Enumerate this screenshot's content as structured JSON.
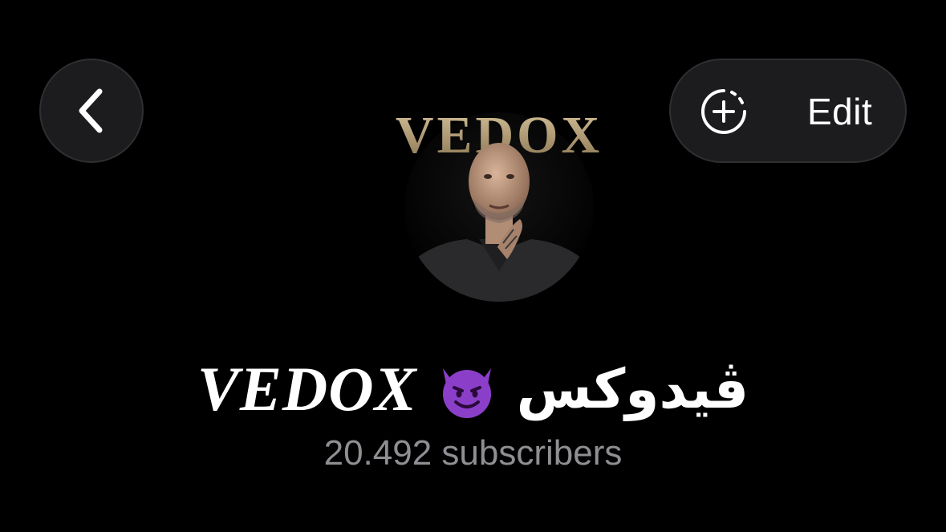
{
  "header": {
    "back_icon": "chevron-left-icon",
    "edit_icon": "add-story-icon",
    "edit_label": "Edit"
  },
  "profile": {
    "avatar_logo_text": "VEDOX",
    "name_latin": "VEDOX",
    "name_emoji": "smiling-face-with-horns-icon",
    "name_arabic": "ڤيدوكس",
    "subscribers": "20.492 subscribers"
  },
  "colors": {
    "background": "#000000",
    "button_bg": "#1c1c1e",
    "secondary_text": "#8e8e93",
    "devil_purple": "#8b3fc9",
    "logo_gold": "#b8a27a"
  }
}
